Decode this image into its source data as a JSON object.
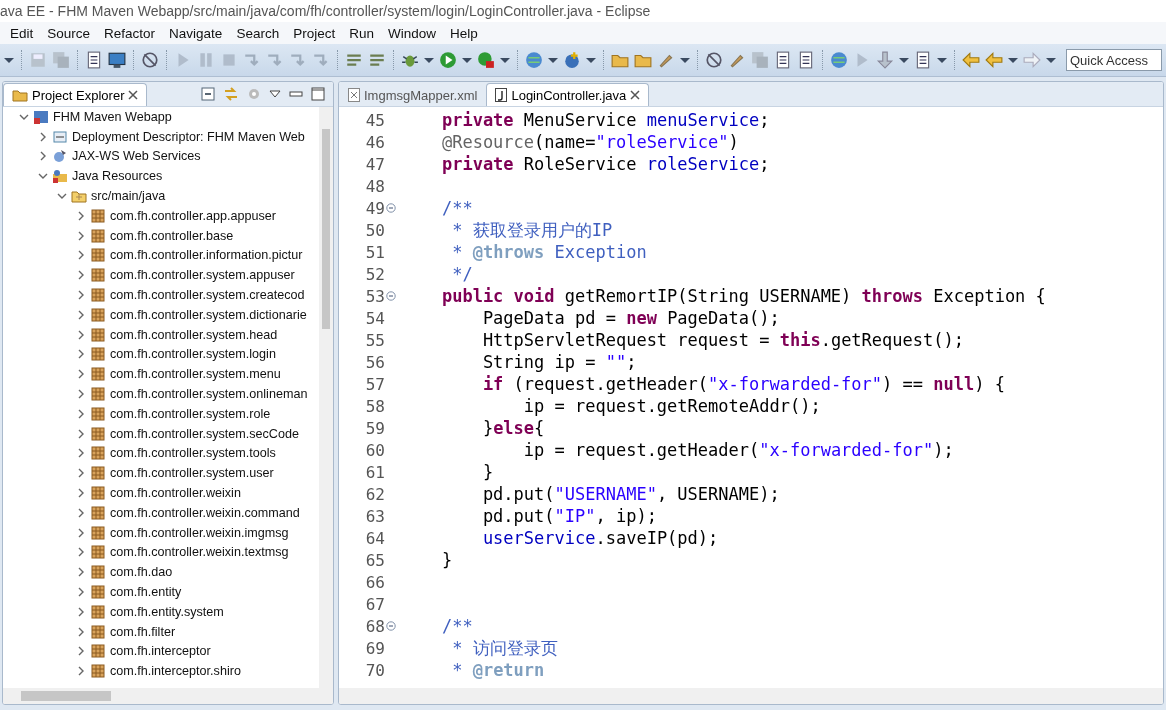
{
  "window": {
    "title": "ava EE - FHM Maven Webapp/src/main/java/com/fh/controller/system/login/LoginController.java - Eclipse"
  },
  "menu": [
    "Edit",
    "Source",
    "Refactor",
    "Navigate",
    "Search",
    "Project",
    "Run",
    "Window",
    "Help"
  ],
  "quick_access": {
    "placeholder": "Quick Access"
  },
  "explorer": {
    "tab": {
      "label": "Project Explorer",
      "selected": true
    },
    "tree": [
      {
        "label": "FHM Maven Webapp",
        "kind": "project",
        "expanded": true,
        "children": [
          {
            "label": "Deployment Descriptor: FHM Maven Web",
            "kind": "descriptor",
            "expanded": false
          },
          {
            "label": "JAX-WS Web Services",
            "kind": "webservice",
            "expanded": false
          },
          {
            "label": "Java Resources",
            "kind": "resources",
            "expanded": true,
            "children": [
              {
                "label": "src/main/java",
                "kind": "source-folder",
                "expanded": true,
                "children": [
                  {
                    "label": "com.fh.controller.app.appuser",
                    "kind": "package",
                    "expanded": false
                  },
                  {
                    "label": "com.fh.controller.base",
                    "kind": "package",
                    "expanded": false
                  },
                  {
                    "label": "com.fh.controller.information.pictur",
                    "kind": "package",
                    "expanded": false
                  },
                  {
                    "label": "com.fh.controller.system.appuser",
                    "kind": "package",
                    "expanded": false
                  },
                  {
                    "label": "com.fh.controller.system.createcod",
                    "kind": "package",
                    "expanded": false
                  },
                  {
                    "label": "com.fh.controller.system.dictionarie",
                    "kind": "package",
                    "expanded": false
                  },
                  {
                    "label": "com.fh.controller.system.head",
                    "kind": "package",
                    "expanded": false
                  },
                  {
                    "label": "com.fh.controller.system.login",
                    "kind": "package",
                    "expanded": false
                  },
                  {
                    "label": "com.fh.controller.system.menu",
                    "kind": "package",
                    "expanded": false
                  },
                  {
                    "label": "com.fh.controller.system.onlineman",
                    "kind": "package",
                    "expanded": false
                  },
                  {
                    "label": "com.fh.controller.system.role",
                    "kind": "package",
                    "expanded": false
                  },
                  {
                    "label": "com.fh.controller.system.secCode",
                    "kind": "package",
                    "expanded": false
                  },
                  {
                    "label": "com.fh.controller.system.tools",
                    "kind": "package",
                    "expanded": false
                  },
                  {
                    "label": "com.fh.controller.system.user",
                    "kind": "package",
                    "expanded": false
                  },
                  {
                    "label": "com.fh.controller.weixin",
                    "kind": "package",
                    "expanded": false
                  },
                  {
                    "label": "com.fh.controller.weixin.command",
                    "kind": "package",
                    "expanded": false
                  },
                  {
                    "label": "com.fh.controller.weixin.imgmsg",
                    "kind": "package",
                    "expanded": false
                  },
                  {
                    "label": "com.fh.controller.weixin.textmsg",
                    "kind": "package",
                    "expanded": false
                  },
                  {
                    "label": "com.fh.dao",
                    "kind": "package",
                    "expanded": false
                  },
                  {
                    "label": "com.fh.entity",
                    "kind": "package",
                    "expanded": false
                  },
                  {
                    "label": "com.fh.entity.system",
                    "kind": "package",
                    "expanded": false
                  },
                  {
                    "label": "com.fh.filter",
                    "kind": "package",
                    "expanded": false
                  },
                  {
                    "label": "com.fh.interceptor",
                    "kind": "package",
                    "expanded": false
                  },
                  {
                    "label": "com.fh.interceptor.shiro",
                    "kind": "package",
                    "expanded": false
                  }
                ]
              }
            ]
          }
        ]
      }
    ]
  },
  "editor": {
    "tabs": [
      {
        "label": "ImgmsgMapper.xml",
        "kind": "xml",
        "selected": false
      },
      {
        "label": "LoginController.java",
        "kind": "java",
        "selected": true
      }
    ],
    "lines": [
      {
        "number": "45",
        "foldable": false,
        "tokens": [
          {
            "kind": "kw",
            "text": "    private"
          },
          {
            "kind": "plain",
            "text": " MenuService "
          },
          {
            "kind": "field",
            "text": "menuService"
          },
          {
            "kind": "plain",
            "text": ";"
          }
        ]
      },
      {
        "number": "46",
        "foldable": false,
        "tokens": [
          {
            "kind": "ann",
            "text": "    @Resource"
          },
          {
            "kind": "plain",
            "text": "(name="
          },
          {
            "kind": "str",
            "text": "\"roleService\""
          },
          {
            "kind": "plain",
            "text": ")"
          }
        ]
      },
      {
        "number": "47",
        "foldable": false,
        "tokens": [
          {
            "kind": "kw",
            "text": "    private"
          },
          {
            "kind": "plain",
            "text": " RoleService "
          },
          {
            "kind": "field",
            "text": "roleService"
          },
          {
            "kind": "plain",
            "text": ";"
          }
        ]
      },
      {
        "number": "48",
        "foldable": false
      },
      {
        "number": "49",
        "foldable": true,
        "tokens": [
          {
            "kind": "comment",
            "text": "    /**"
          }
        ]
      },
      {
        "number": "50",
        "foldable": false,
        "tokens": [
          {
            "kind": "comment",
            "text": "     * 获取登录用户的IP"
          }
        ]
      },
      {
        "number": "51",
        "foldable": false,
        "tokens": [
          {
            "kind": "comment",
            "text": "     * "
          },
          {
            "kind": "tag",
            "text": "@throws"
          },
          {
            "kind": "comment",
            "text": " Exception"
          }
        ]
      },
      {
        "number": "52",
        "foldable": false,
        "tokens": [
          {
            "kind": "comment",
            "text": "     */"
          }
        ]
      },
      {
        "number": "53",
        "foldable": true,
        "tokens": [
          {
            "kind": "kw",
            "text": "    public void"
          },
          {
            "kind": "plain",
            "text": " getRemortIP(String USERNAME) "
          },
          {
            "kind": "kw",
            "text": "throws"
          },
          {
            "kind": "plain",
            "text": " Exception {"
          }
        ]
      },
      {
        "number": "54",
        "foldable": false,
        "tokens": [
          {
            "kind": "plain",
            "text": "        PageData pd = "
          },
          {
            "kind": "kw",
            "text": "new"
          },
          {
            "kind": "plain",
            "text": " PageData();"
          }
        ]
      },
      {
        "number": "55",
        "foldable": false,
        "tokens": [
          {
            "kind": "plain",
            "text": "        HttpServletRequest request = "
          },
          {
            "kind": "kw",
            "text": "this"
          },
          {
            "kind": "plain",
            "text": ".getRequest();"
          }
        ]
      },
      {
        "number": "56",
        "foldable": false,
        "tokens": [
          {
            "kind": "plain",
            "text": "        String ip = "
          },
          {
            "kind": "str",
            "text": "\"\""
          },
          {
            "kind": "plain",
            "text": ";"
          }
        ]
      },
      {
        "number": "57",
        "foldable": false,
        "tokens": [
          {
            "kind": "kw",
            "text": "        if"
          },
          {
            "kind": "plain",
            "text": " (request.getHeader("
          },
          {
            "kind": "str",
            "text": "\"x-forwarded-for\""
          },
          {
            "kind": "plain",
            "text": ") == "
          },
          {
            "kind": "kw",
            "text": "null"
          },
          {
            "kind": "plain",
            "text": ") {"
          }
        ]
      },
      {
        "number": "58",
        "foldable": false,
        "tokens": [
          {
            "kind": "plain",
            "text": "            ip = request.getRemoteAddr();"
          }
        ]
      },
      {
        "number": "59",
        "foldable": false,
        "tokens": [
          {
            "kind": "plain",
            "text": "        }"
          },
          {
            "kind": "kw",
            "text": "else"
          },
          {
            "kind": "plain",
            "text": "{"
          }
        ]
      },
      {
        "number": "60",
        "foldable": false,
        "tokens": [
          {
            "kind": "plain",
            "text": "            ip = request.getHeader("
          },
          {
            "kind": "str",
            "text": "\"x-forwarded-for\""
          },
          {
            "kind": "plain",
            "text": ");"
          }
        ]
      },
      {
        "number": "61",
        "foldable": false,
        "tokens": [
          {
            "kind": "plain",
            "text": "        }"
          }
        ]
      },
      {
        "number": "62",
        "foldable": false,
        "tokens": [
          {
            "kind": "plain",
            "text": "        pd.put("
          },
          {
            "kind": "str",
            "text": "\"USERNAME\""
          },
          {
            "kind": "plain",
            "text": ", USERNAME);"
          }
        ]
      },
      {
        "number": "63",
        "foldable": false,
        "tokens": [
          {
            "kind": "plain",
            "text": "        pd.put("
          },
          {
            "kind": "str",
            "text": "\"IP\""
          },
          {
            "kind": "plain",
            "text": ", ip);"
          }
        ]
      },
      {
        "number": "64",
        "foldable": false,
        "tokens": [
          {
            "kind": "field",
            "text": "        userService"
          },
          {
            "kind": "plain",
            "text": ".saveIP(pd);"
          }
        ]
      },
      {
        "number": "65",
        "foldable": false,
        "tokens": [
          {
            "kind": "plain",
            "text": "    }"
          }
        ]
      },
      {
        "number": "66",
        "foldable": false
      },
      {
        "number": "67",
        "foldable": false
      },
      {
        "number": "68",
        "foldable": true,
        "tokens": [
          {
            "kind": "comment",
            "text": "    /**"
          }
        ]
      },
      {
        "number": "69",
        "foldable": false,
        "tokens": [
          {
            "kind": "comment",
            "text": "     * 访问登录页"
          }
        ]
      },
      {
        "number": "70",
        "foldable": false,
        "tokens": [
          {
            "kind": "comment",
            "text": "     * "
          },
          {
            "kind": "tag",
            "text": "@return"
          }
        ]
      }
    ]
  }
}
